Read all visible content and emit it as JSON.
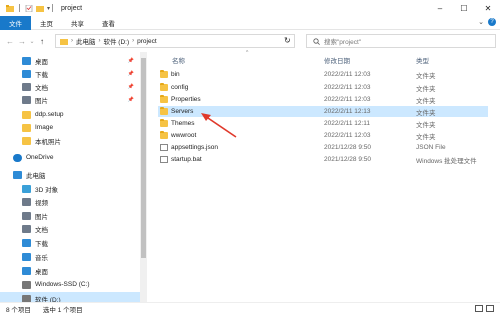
{
  "window": {
    "title": "project",
    "controls": {
      "minimize": "–",
      "maximize": "☐",
      "close": "✕"
    }
  },
  "ribbon": {
    "tabs": [
      "文件",
      "主页",
      "共享",
      "查看"
    ],
    "help": "?"
  },
  "address": {
    "back": "←",
    "forward": "→",
    "recent": "⌄",
    "up": "↑",
    "crumbs": [
      "此电脑",
      "软件 (D:)",
      "project"
    ],
    "search_placeholder": "搜索\"project\""
  },
  "nav_pane": {
    "items": [
      {
        "label": "桌面",
        "icon": "desktop-icon",
        "pinned": true
      },
      {
        "label": "下载",
        "icon": "download-icon",
        "pinned": true
      },
      {
        "label": "文档",
        "icon": "document-icon",
        "pinned": true
      },
      {
        "label": "图片",
        "icon": "picture-icon",
        "pinned": true
      },
      {
        "label": "ddp.setup",
        "icon": "folder-icon",
        "pinned": false
      },
      {
        "label": "Image",
        "icon": "folder-icon",
        "pinned": false
      },
      {
        "label": "本机照片",
        "icon": "folder-icon",
        "pinned": false
      },
      {
        "label": "OneDrive",
        "icon": "cloud-icon",
        "pinned": false
      },
      {
        "label": "此电脑",
        "icon": "computer-icon",
        "pinned": false
      },
      {
        "label": "3D 对象",
        "icon": "cube-icon",
        "pinned": false
      },
      {
        "label": "视频",
        "icon": "video-icon",
        "pinned": false
      },
      {
        "label": "图片",
        "icon": "picture-icon",
        "pinned": false
      },
      {
        "label": "文档",
        "icon": "document-icon",
        "pinned": false
      },
      {
        "label": "下载",
        "icon": "download-icon",
        "pinned": false
      },
      {
        "label": "音乐",
        "icon": "music-icon",
        "pinned": false
      },
      {
        "label": "桌面",
        "icon": "desktop-icon",
        "pinned": false
      },
      {
        "label": "Windows-SSD (C:)",
        "icon": "drive-icon",
        "pinned": false
      },
      {
        "label": "软件 (D:)",
        "icon": "drive-icon",
        "pinned": false
      }
    ],
    "pin_glyph": "📌"
  },
  "file_list": {
    "columns": {
      "name": "名称",
      "date": "修改日期",
      "type": "类型",
      "sort": "^"
    },
    "rows": [
      {
        "name": "bin",
        "date": "2022/2/11 12:03",
        "type": "文件夹",
        "kind": "folder"
      },
      {
        "name": "config",
        "date": "2022/2/11 12:03",
        "type": "文件夹",
        "kind": "folder"
      },
      {
        "name": "Properties",
        "date": "2022/2/11 12:03",
        "type": "文件夹",
        "kind": "folder"
      },
      {
        "name": "Servers",
        "date": "2022/2/11 12:13",
        "type": "文件夹",
        "kind": "folder"
      },
      {
        "name": "Themes",
        "date": "2022/2/11 12:11",
        "type": "文件夹",
        "kind": "folder"
      },
      {
        "name": "wwwroot",
        "date": "2022/2/11 12:03",
        "type": "文件夹",
        "kind": "folder"
      },
      {
        "name": "appsettings.json",
        "date": "2021/12/28 9:50",
        "type": "JSON File",
        "kind": "file"
      },
      {
        "name": "startup.bat",
        "date": "2021/12/28 9:50",
        "type": "Windows 批处理文件",
        "kind": "file"
      }
    ]
  },
  "status": {
    "count": "8 个项目",
    "selection": "选中 1 个项目"
  },
  "colors": {
    "accent": "#1979ca",
    "selection": "#cce8ff",
    "folder": "#f6c344",
    "annotation_arrow": "#e0392b"
  }
}
